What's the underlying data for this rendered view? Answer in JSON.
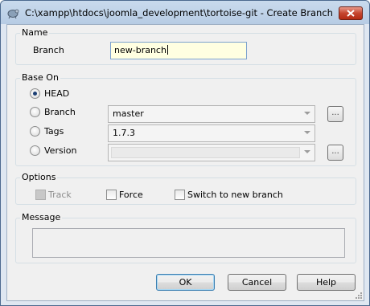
{
  "window": {
    "title": "C:\\xampp\\htdocs\\joomla_development\\tortoise-git - Create Branch - T...",
    "icon": "tortoisegit-app-icon",
    "close_icon": "close-icon"
  },
  "name_group": {
    "legend": "Name",
    "branch_label": "Branch",
    "branch_value": "new-branch"
  },
  "base_on": {
    "legend": "Base On",
    "head_label": "HEAD",
    "branch_label": "Branch",
    "branch_value": "master",
    "tags_label": "Tags",
    "tags_value": "1.7.3",
    "version_label": "Version",
    "version_value": "",
    "browse_label": "...",
    "selected": "HEAD"
  },
  "options": {
    "legend": "Options",
    "track_label": "Track",
    "force_label": "Force",
    "switch_label": "Switch to new branch",
    "track_checked": false,
    "force_checked": false,
    "switch_checked": false
  },
  "message": {
    "legend": "Message",
    "value": ""
  },
  "buttons": {
    "ok": "OK",
    "cancel": "Cancel",
    "help": "Help"
  }
}
